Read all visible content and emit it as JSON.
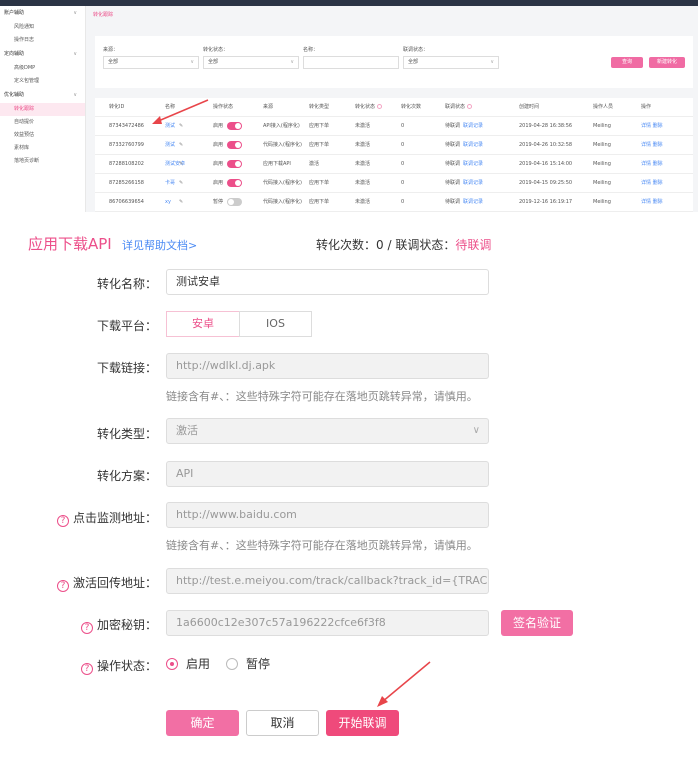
{
  "sidebar": {
    "groups": [
      {
        "label": "账户辅助",
        "items": [
          "风险通知",
          "操作日志"
        ]
      },
      {
        "label": "定向辅助",
        "items": [
          "高级DMP",
          "定义包管理"
        ]
      },
      {
        "label": "优化辅助",
        "items": [
          "转化跟踪",
          "自动提价",
          "效益预估",
          "素材库",
          "落地页诊断"
        ]
      }
    ],
    "active": "转化跟踪"
  },
  "breadcrumb": "转化跟踪",
  "filters": {
    "source_label": "来源：",
    "source_value": "全部",
    "status_label": "转化状态：",
    "status_value": "全部",
    "name_label": "名称：",
    "name_value": "",
    "link_label": "联调状态：",
    "link_value": "全部",
    "query_button": "查询",
    "new_button": "新建转化"
  },
  "table": {
    "headers": [
      "转化ID",
      "名称",
      "操作状态",
      "来源",
      "转化类型",
      "转化状态",
      "转化次数",
      "联调状态",
      "创建时间",
      "操作人员",
      "操作"
    ],
    "rows": [
      {
        "id": "87343472486",
        "name": "测试",
        "op": "启用",
        "on": true,
        "source": "API接入(程序化)",
        "type": "应用下单",
        "status": "未激活",
        "count": "0",
        "link": "待联调",
        "link_action": "联调记录",
        "time": "2019-04-28 16:38:56",
        "user": "Meiling",
        "actions": "详情 删除"
      },
      {
        "id": "87332760799",
        "name": "测试",
        "op": "启用",
        "on": true,
        "source": "代码接入(程序化)",
        "type": "应用下单",
        "status": "未激活",
        "count": "0",
        "link": "待联调",
        "link_action": "联调记录",
        "time": "2019-04-26 10:32:58",
        "user": "Meiling",
        "actions": "详情 删除"
      },
      {
        "id": "87288108202",
        "name": "测试安卓",
        "op": "启用",
        "on": true,
        "source": "应用下载API",
        "type": "激活",
        "status": "未激活",
        "count": "0",
        "link": "待联调",
        "link_action": "联调记录",
        "time": "2019-04-16 15:14:00",
        "user": "Meiling",
        "actions": "详情 删除"
      },
      {
        "id": "87285266158",
        "name": "卡哥",
        "op": "启用",
        "on": true,
        "source": "代码接入(程序化)",
        "type": "应用下单",
        "status": "未激活",
        "count": "0",
        "link": "待联调",
        "link_action": "联调记录",
        "time": "2019-04-15 09:25:50",
        "user": "Meiling",
        "actions": "详情 删除"
      },
      {
        "id": "86706639654",
        "name": "xy",
        "op": "暂停",
        "on": false,
        "source": "代码接入(程序化)",
        "type": "应用下单",
        "status": "未激活",
        "count": "0",
        "link": "待联调",
        "link_action": "联调记录",
        "time": "2019-12-16 16:19:17",
        "user": "Meiling",
        "actions": "详情 删除"
      }
    ]
  },
  "form": {
    "title": "应用下载API",
    "help_link": "详见帮助文档>",
    "stat_prefix": "转化次数：",
    "stat_count": "0",
    "stat_sep": " / ",
    "stat_link_label": "联调状态：",
    "stat_link_value": "待联调",
    "name_label": "转化名称：",
    "name_value": "测试安卓",
    "platform_label": "下载平台：",
    "platform_options": [
      "安卓",
      "IOS"
    ],
    "platform_selected": "安卓",
    "link_label": "下载链接：",
    "link_value": "http://wdlkl.dj.apk",
    "char_hint": "链接含有#、：这些特殊字符可能存在落地页跳转异常，请慎用。",
    "type_label": "转化类型：",
    "type_value": "激活",
    "scheme_label": "转化方案：",
    "scheme_value": "API",
    "click_label": "点击监测地址：",
    "click_value": "http://www.baidu.com",
    "callback_label": "激活回传地址：",
    "callback_value": "http://test.e.meiyou.com/track/callback?track_id={TRACK_ID}",
    "key_label": "加密秘钥：",
    "key_value": "1a6600c12e307c57a196222cfce6f3f8",
    "sign_button": "签名验证",
    "opstate_label": "操作状态：",
    "opstate_on": "启用",
    "opstate_off": "暂停",
    "confirm_button": "确定",
    "cancel_button": "取消",
    "start_button": "开始联调"
  },
  "colors": {
    "accent": "#ec4f8a",
    "link": "#4a8af4"
  }
}
